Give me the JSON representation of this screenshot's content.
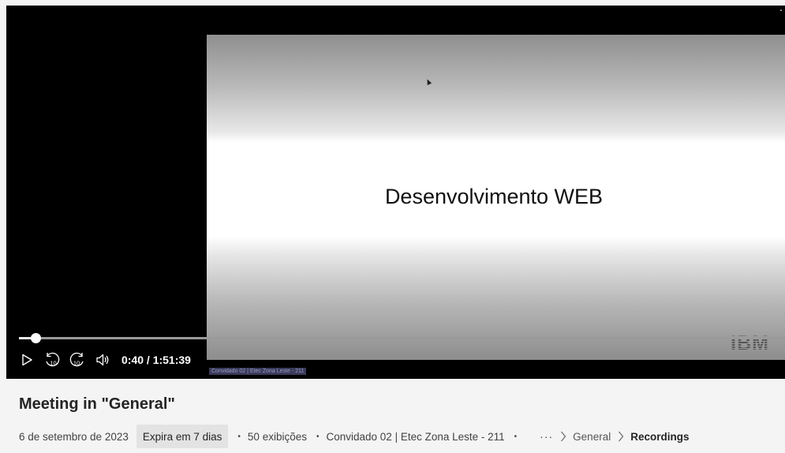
{
  "video": {
    "slide_title": "Desenvolvimento WEB",
    "logo_text": "IBM",
    "participant_tag": "Convidado 02 | Etec Zona Leste - 211",
    "progress_fraction": 0.022,
    "time": "0:40 / 1:51:39",
    "controls": {
      "play": "play-icon",
      "rewind": "rewind-10-icon",
      "forward": "forward-10-icon",
      "volume": "volume-icon",
      "skip_label": "10"
    }
  },
  "meeting": {
    "title": "Meeting in \"General\"",
    "date": "6 de setembro de 2023",
    "expiry": "Expira em 7 dias",
    "views": "50 exibições",
    "author": "Convidado 02 | Etec Zona Leste - 211",
    "separator": "•",
    "more": "···",
    "breadcrumb": [
      {
        "label": "General"
      },
      {
        "label": "Recordings"
      }
    ]
  }
}
